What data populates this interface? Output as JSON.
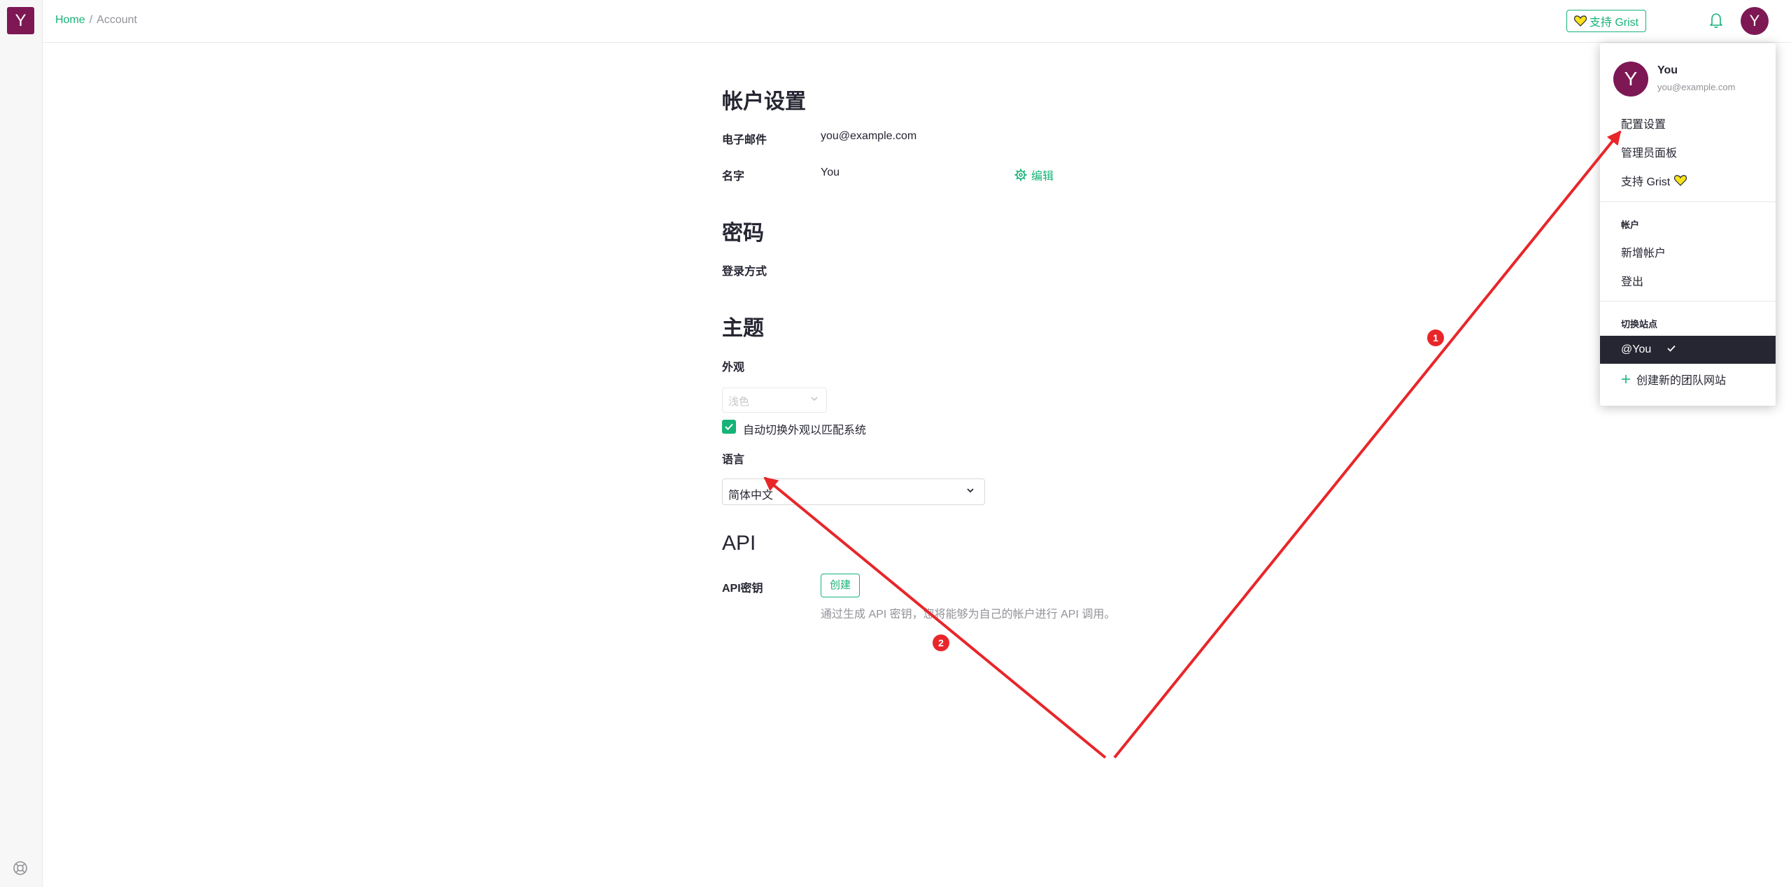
{
  "rail": {
    "logo_letter": "Y",
    "help_icon": "lifebuoy-icon"
  },
  "topbar": {
    "breadcrumb_home": "Home",
    "breadcrumb_sep": "/",
    "breadcrumb_current": "Account",
    "support_label": "支持 Grist",
    "bell_icon": "bell-icon",
    "avatar_letter": "Y"
  },
  "account": {
    "title": "帐户设置",
    "email_label": "电子邮件",
    "email_value": "you@example.com",
    "name_label": "名字",
    "name_value": "You",
    "edit_label": "编辑"
  },
  "password": {
    "title": "密码",
    "login_method_label": "登录方式"
  },
  "theme": {
    "title": "主题",
    "appearance_label": "外观",
    "appearance_value": "浅色",
    "auto_switch_label": "自动切换外观以匹配系统",
    "auto_switch_checked": true,
    "language_label": "语言",
    "language_value": "简体中文"
  },
  "api": {
    "title": "API",
    "key_label": "API密钥",
    "create_label": "创建",
    "description": "通过生成 API 密钥，您将能够为自己的帐户进行 API 调用。"
  },
  "menu": {
    "avatar_letter": "Y",
    "user_name": "You",
    "user_email": "you@example.com",
    "item_profile": "配置设置",
    "item_admin": "管理员面板",
    "item_support": "支持 Grist",
    "accounts_header": "帐户",
    "item_add_account": "新增帐户",
    "item_sign_out": "登出",
    "switch_site_header": "切换站点",
    "current_site": "@You",
    "item_create_team": "创建新的团队网站"
  },
  "annotations": {
    "badge_1": "1",
    "badge_2": "2",
    "arrow_color": "#e8262a"
  },
  "colors": {
    "brand": "#7d1854",
    "accent": "#16b378",
    "dark": "#262633"
  }
}
